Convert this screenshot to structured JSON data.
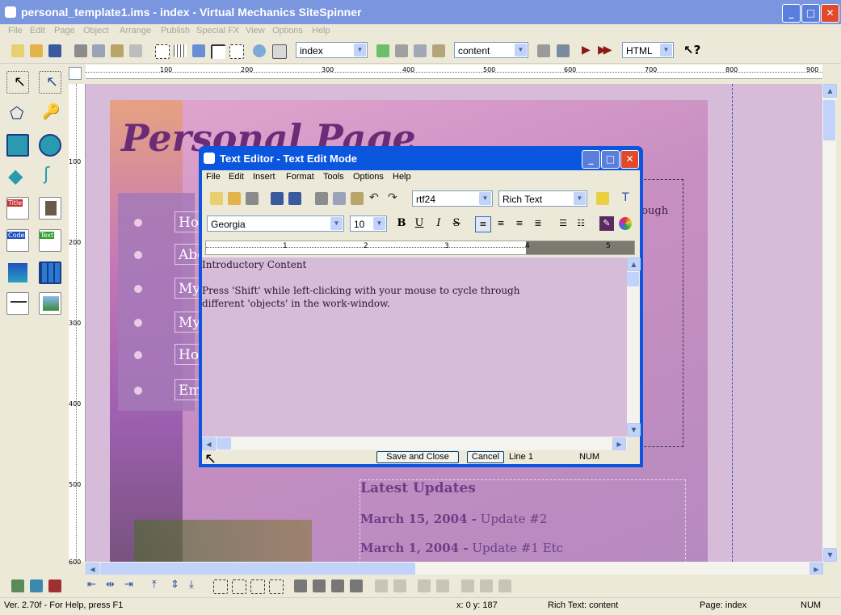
{
  "window": {
    "title": "personal_template1.ims - index - Virtual Mechanics SiteSpinner"
  },
  "menu": [
    "File",
    "Edit",
    "Page",
    "Object",
    "Arrange",
    "Publish",
    "Special FX",
    "View",
    "Options",
    "Help"
  ],
  "toolbar": {
    "page_combo": "index",
    "layer_combo": "content",
    "output_combo": "HTML"
  },
  "ruler": {
    "h_ticks": [
      "100",
      "200",
      "300",
      "400",
      "500",
      "600",
      "700",
      "800",
      "900"
    ],
    "v_ticks": [
      "100",
      "200",
      "300",
      "400",
      "500",
      "600"
    ]
  },
  "tools": {
    "title_label": "Title",
    "code_label": "Code",
    "text_label": "Text"
  },
  "page": {
    "heading": "Personal Page",
    "nav": [
      "Ho",
      "Abo",
      "My",
      "My",
      "Ho",
      "Em"
    ],
    "side_text": "rough",
    "updates_title": "Latest Updates",
    "updates": [
      {
        "date": "March 15, 2004 -",
        "text": "Update #2"
      },
      {
        "date": "March 1, 2004 -",
        "text": "Update #1  Etc"
      }
    ]
  },
  "editor": {
    "title": "Text Editor -  Text Edit Mode",
    "menu": [
      "File",
      "Edit",
      "Insert",
      "Format",
      "Tools",
      "Options",
      "Help"
    ],
    "style_combo": "rtf24",
    "mode_combo": "Rich Text",
    "font_combo": "Georgia",
    "size_combo": "10",
    "ruler_nums": [
      "1",
      "2",
      "3",
      "4",
      "5"
    ],
    "lines": [
      "Introductory Content",
      "",
      "Press 'Shift' while left-clicking with your mouse to cycle through",
      "different 'objects' in the work-window."
    ],
    "save_close": "Save and Close",
    "cancel": "Cancel",
    "line_status": "Line 1",
    "num": "NUM"
  },
  "status": {
    "version": "Ver. 2.70f - For Help, press F1",
    "coords": "x: 0  y: 187",
    "object": "Rich Text: content",
    "page": "Page:  index",
    "num": "NUM"
  }
}
